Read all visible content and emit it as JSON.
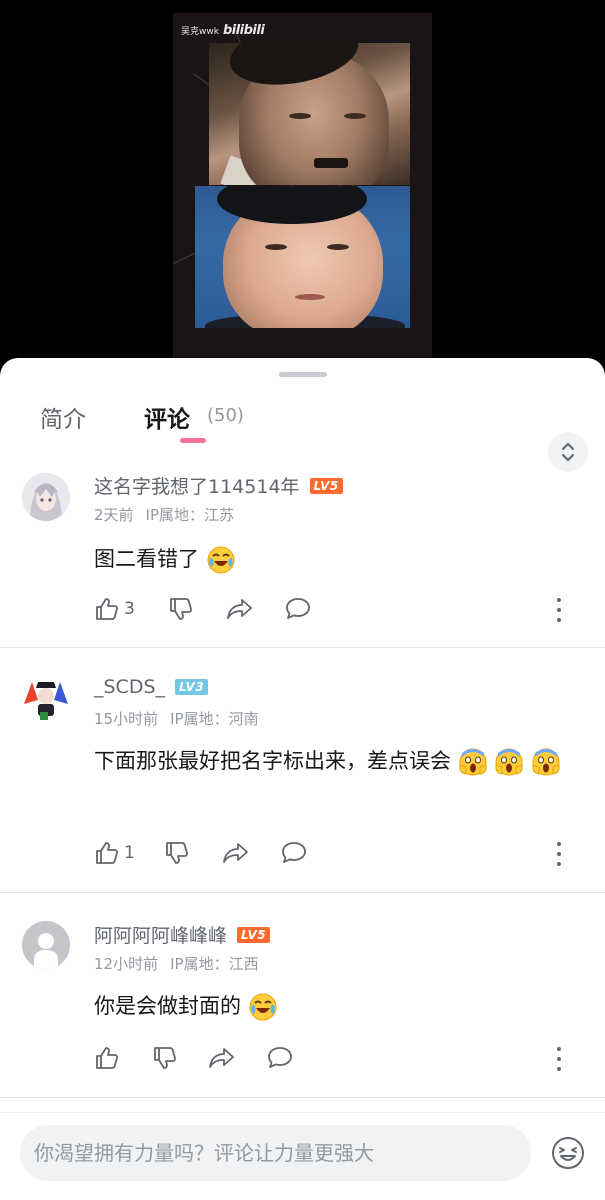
{
  "video": {
    "watermark_user": "吴克wwk",
    "watermark_brand": "bilibili"
  },
  "tabs": {
    "intro": "简介",
    "comments": "评论",
    "count": "(50)"
  },
  "comments": [
    {
      "name": "这名字我想了114514年",
      "level": "LV5",
      "level_color": "#ff6a2c",
      "time": "2天前",
      "ip": "IP属地：江苏",
      "text": "图二看错了",
      "emojis": [
        "crying-laugh-emoji"
      ],
      "likes": "3"
    },
    {
      "name": "_SCDS_",
      "level": "LV3",
      "level_color": "#73c9e5",
      "time": "15小时前",
      "ip": "IP属地：河南",
      "text": "下面那张最好把名字标出来，差点误会",
      "emojis": [
        "scream-emoji",
        "scream-emoji",
        "scream-emoji"
      ],
      "likes": "1"
    },
    {
      "name": "阿阿阿阿峰峰峰",
      "level": "LV5",
      "level_color": "#ff6a2c",
      "time": "12小时前",
      "ip": "IP属地：江西",
      "text": "你是会做封面的",
      "emojis": [
        "crying-laugh-emoji"
      ],
      "likes": ""
    }
  ],
  "input": {
    "placeholder": "你渴望拥有力量吗？评论让力量更强大"
  },
  "colors": {
    "accent_pink": "#fb7299",
    "text_primary": "#18191c",
    "text_secondary": "#61666d",
    "text_muted": "#9499a0"
  }
}
